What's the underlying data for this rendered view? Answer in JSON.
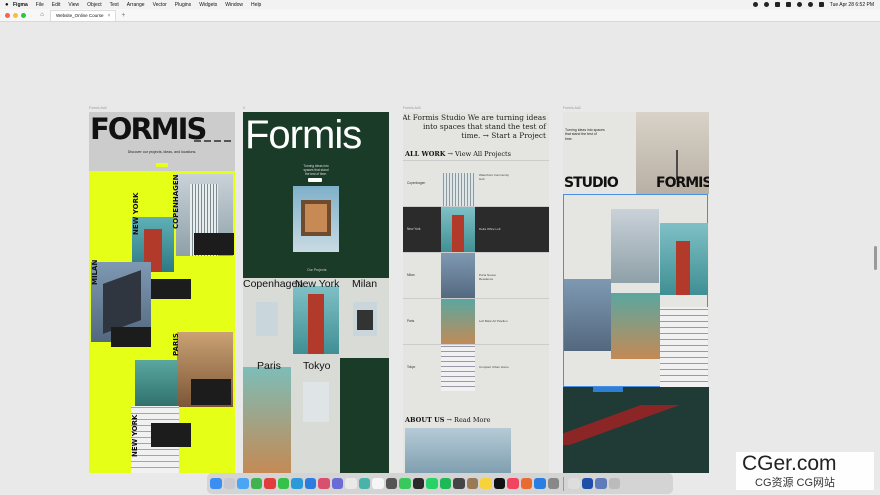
{
  "menubar": {
    "app": "Figma",
    "items": [
      "File",
      "Edit",
      "View",
      "Object",
      "Text",
      "Arrange",
      "Vector",
      "Plugins",
      "Widgets",
      "Window",
      "Help"
    ],
    "clock": "Tue Apr 28  6:52 PM"
  },
  "tabbar": {
    "tab_title": "Website_Online Course",
    "close": "×",
    "plus": "+"
  },
  "canvas": {
    "frame1": {
      "label": "Formis Ad4",
      "logo": "FORMIS",
      "tagline": "Discover our projects, ideas, and locations.",
      "cities": [
        "NEW YORK",
        "COPENHAGEN",
        "MILAN",
        "PARIS",
        "NEW YORK"
      ]
    },
    "frame2": {
      "label": "V",
      "logo": "Formis",
      "tagline": "Turning ideas into spaces that stand the test of time.",
      "chapter": "Our Projects",
      "cities": [
        "Copenhagen",
        "New York",
        "Milan",
        "Paris",
        "Tokyo"
      ]
    },
    "frame3": {
      "label": "Formis Ad3",
      "heading": "At Formis Studio We are turning ideas into spaces that stand the test of time. → Start a Project",
      "allwork_bold": "ALL WORK",
      "allwork_link": "→ View All Projects",
      "rows": [
        {
          "city": "Copenhagen",
          "desc": "Waterfront Community Hub"
        },
        {
          "city": "New York",
          "desc": "Delta Office Loft"
        },
        {
          "city": "Milan",
          "desc": "Porta Nuova Residence"
        },
        {
          "city": "Paris",
          "desc": "Left Bank Art Pavilion"
        },
        {
          "city": "Tokyo",
          "desc": "Compact Urban Home"
        }
      ],
      "about_bold": "ABOUT US",
      "about_link": "→ Read More"
    },
    "frame4": {
      "label": "Formis Ad2",
      "tagline": "Turning ideas into spaces that stand the test of time.",
      "studio": "STUDIO",
      "formis": "FORMIS"
    }
  },
  "watermark": {
    "big": "CGer.com",
    "small": "CG资源 CG网站"
  },
  "colors": {
    "yellow": "#e6ff17",
    "green": "#1b3b29",
    "selection": "#4a90e2"
  }
}
